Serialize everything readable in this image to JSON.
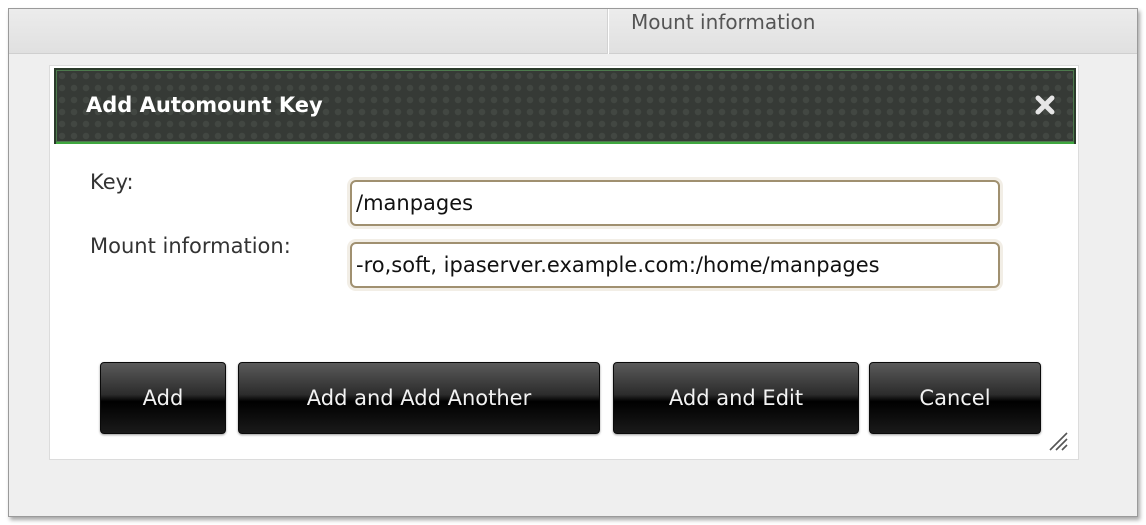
{
  "background": {
    "column_header": "Mount information"
  },
  "dialog": {
    "title": "Add Automount Key",
    "close_icon": "close-icon",
    "fields": {
      "key": {
        "label": "Key:",
        "value": "/manpages"
      },
      "mount_info": {
        "label": "Mount information:",
        "value": "-ro,soft, ipaserver.example.com:/home/manpages"
      }
    },
    "buttons": {
      "add": "Add",
      "add_another": "Add and Add Another",
      "add_edit": "Add and Edit",
      "cancel": "Cancel"
    }
  },
  "colors": {
    "titlebar": "#363a36",
    "titlebar_accent": "#3fa63f",
    "button": "#1a1a1a",
    "input_border": "#a09070"
  }
}
